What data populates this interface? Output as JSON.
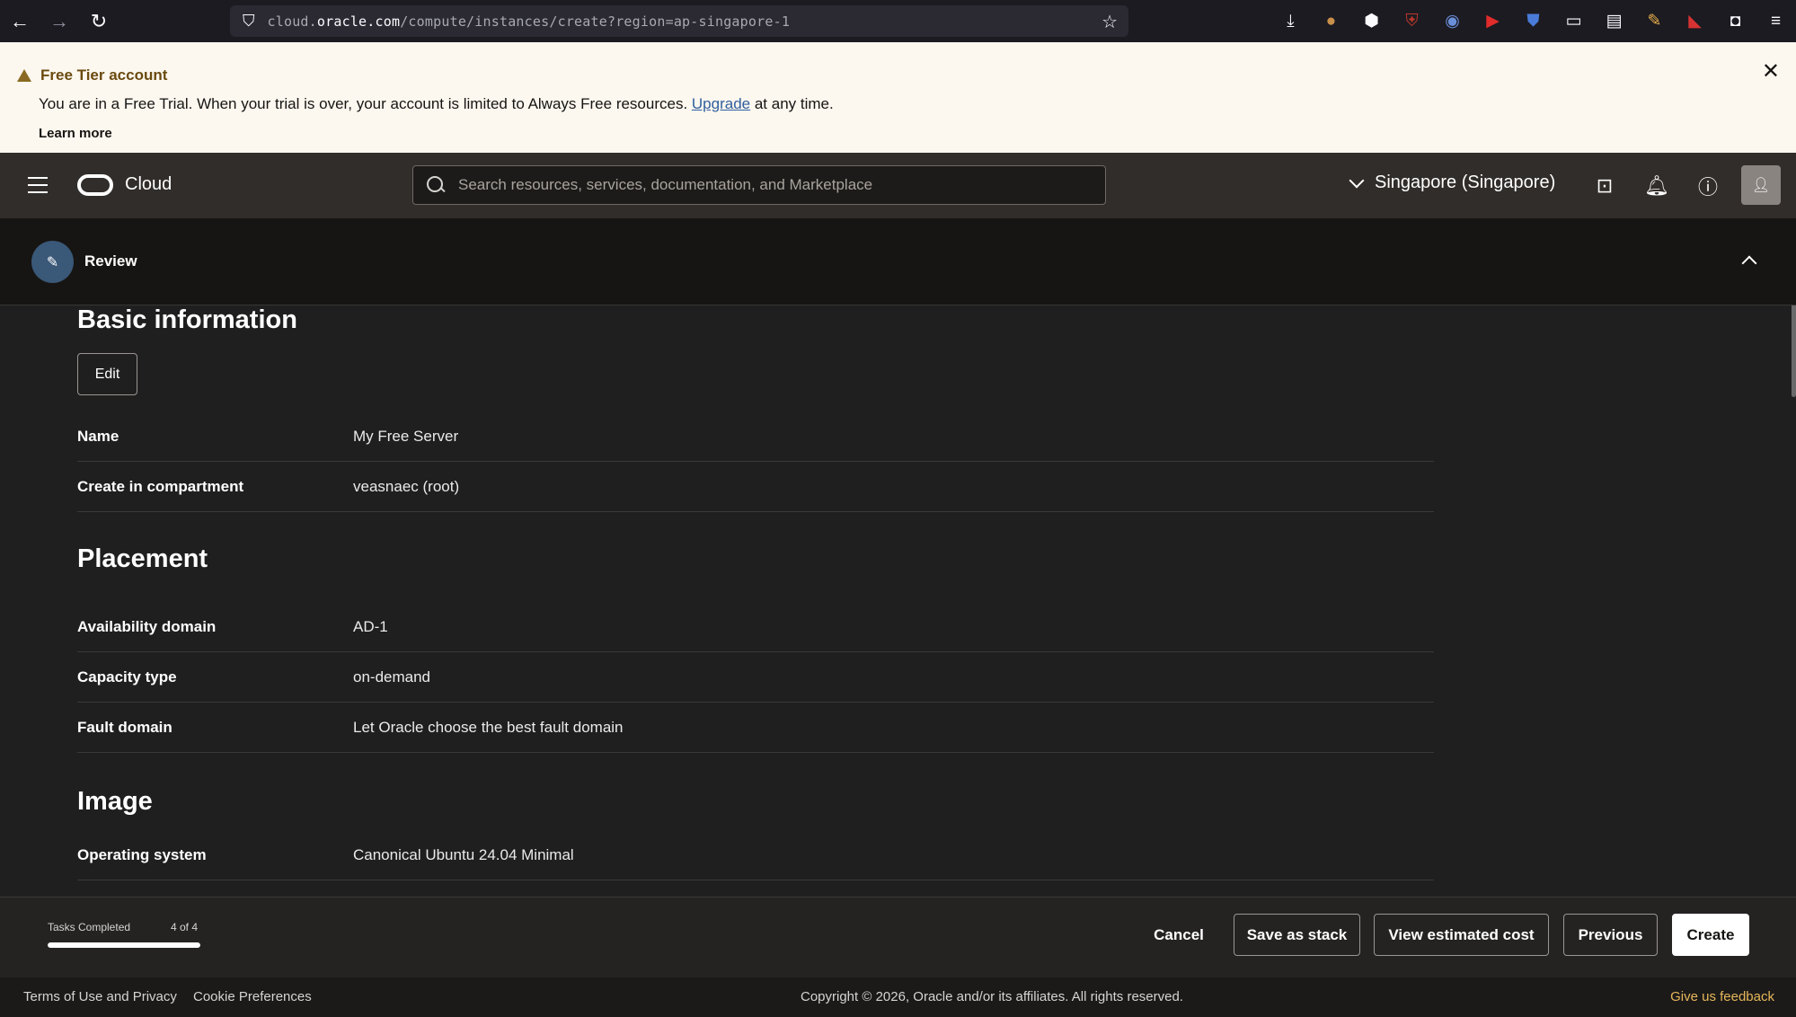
{
  "browser": {
    "url_prefix": "cloud.",
    "url_host": "oracle.com",
    "url_path": "/compute/instances/create?region=ap-singapore-1",
    "extensions": [
      {
        "name": "download-icon",
        "glyph": "⤓",
        "color": "#fbfbfe"
      },
      {
        "name": "cookie-extension-icon",
        "glyph": "●",
        "color": "#c8904a"
      },
      {
        "name": "puzzle-extension-icon",
        "glyph": "⬢",
        "color": "#fbfbfe"
      },
      {
        "name": "ublock-extension-icon",
        "glyph": "⛨",
        "color": "#c0392b"
      },
      {
        "name": "circle-extension-icon",
        "glyph": "◉",
        "color": "#6a8fd8"
      },
      {
        "name": "youtube-extension-icon",
        "glyph": "▶",
        "color": "#e22b2b"
      },
      {
        "name": "bitwarden-extension-icon",
        "glyph": "⛊",
        "color": "#4a7bd8"
      },
      {
        "name": "container-tab-icon",
        "glyph": "▭",
        "color": "#fbfbfe"
      },
      {
        "name": "sidebar-icon",
        "glyph": "▤",
        "color": "#fbfbfe"
      },
      {
        "name": "paint-extension-icon",
        "glyph": "✎",
        "color": "#e8b14a"
      },
      {
        "name": "pdf-extension-icon",
        "glyph": "◣",
        "color": "#d83333"
      },
      {
        "name": "screenshot-icon",
        "glyph": "◘",
        "color": "#fbfbfe"
      },
      {
        "name": "menu-icon",
        "glyph": "≡",
        "color": "#fbfbfe"
      }
    ]
  },
  "banner": {
    "title": "Free Tier account",
    "body_before": "You are in a Free Trial. When your trial is over, your account is limited to Always Free resources. ",
    "upgrade_link": "Upgrade",
    "body_after": " at any time.",
    "learn_more": "Learn more"
  },
  "header": {
    "logo_text": "Cloud",
    "search_placeholder": "Search resources, services, documentation, and Marketplace",
    "region": "Singapore (Singapore)"
  },
  "review": {
    "label": "Review"
  },
  "sections": {
    "basic": {
      "title": "Basic information",
      "edit_label": "Edit",
      "rows": [
        {
          "label": "Name",
          "value": "My Free Server"
        },
        {
          "label": "Create in compartment",
          "value": "veasnaec (root)"
        }
      ]
    },
    "placement": {
      "title": "Placement",
      "rows": [
        {
          "label": "Availability domain",
          "value": "AD-1"
        },
        {
          "label": "Capacity type",
          "value": "on-demand"
        },
        {
          "label": "Fault domain",
          "value": "Let Oracle choose the best fault domain"
        }
      ]
    },
    "image": {
      "title": "Image",
      "rows": [
        {
          "label": "Operating system",
          "value": "Canonical Ubuntu 24.04 Minimal"
        }
      ]
    }
  },
  "actions": {
    "tasks_label": "Tasks Completed",
    "tasks_count": "4 of 4",
    "progress_fraction": 1.0,
    "cancel": "Cancel",
    "save_stack": "Save as stack",
    "estimated_cost": "View estimated cost",
    "previous": "Previous",
    "create": "Create"
  },
  "footer": {
    "terms": "Terms of Use and Privacy",
    "cookies": "Cookie Preferences",
    "copyright": "Copyright © 2026, Oracle and/or its affiliates. All rights reserved.",
    "feedback": "Give us feedback"
  }
}
